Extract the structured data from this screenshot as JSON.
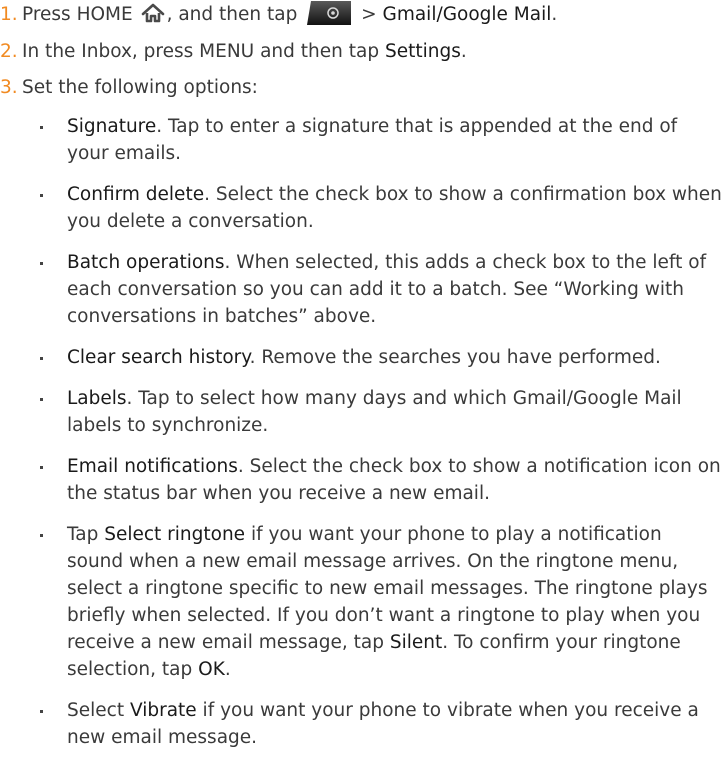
{
  "steps": [
    {
      "num": "1.",
      "p1": "Press HOME ",
      "p2": ", and then tap ",
      "p3": " > ",
      "h1": "Gmail/Google Mail",
      "p4": "."
    },
    {
      "num": "2.",
      "p1": "In the Inbox, press MENU and then tap ",
      "h1": "Settings",
      "p2": "."
    },
    {
      "num": "3.",
      "p1": "Set the following options:"
    }
  ],
  "icons": {
    "home": "home-icon",
    "launcher": "all-apps-launcher-icon"
  },
  "options": [
    {
      "pre": "",
      "hl": "Signature",
      "text": ". Tap to enter a signature that is appended at the end of your emails."
    },
    {
      "pre": "",
      "hl": "Confirm delete",
      "text": ". Select the check box to show a confirmation box when you delete a conversation."
    },
    {
      "pre": "",
      "hl": "Batch operations",
      "text": ". When selected, this adds a check box to the left of each conversation so you can add it to a batch. See “Working with conversations in batches” above."
    },
    {
      "pre": "",
      "hl": "Clear search history",
      "text": ". Remove the searches you have performed."
    },
    {
      "pre": "",
      "hl": "Labels",
      "text": ". Tap to select how many days and which Gmail/Google Mail labels to synchronize."
    },
    {
      "pre": "",
      "hl": "Email notifications",
      "text": ". Select the check box to show a notification icon on the status bar when you receive a new email."
    },
    {
      "pre": "Tap ",
      "hl": "Select ringtone",
      "text": " if you want your phone to play a notification sound when a new email message arrives. On the ringtone menu, select a ringtone specific to new email messages. The ringtone plays briefly when selected. If you don’t want a ringtone to play when you receive a new email message, tap ",
      "hl2": "Silent",
      "text2": ". To confirm your ringtone selection, tap ",
      "hl3": "OK",
      "text3": "."
    },
    {
      "pre": "Select ",
      "hl": "Vibrate",
      "text": " if you want your phone to vibrate when you receive a new email message."
    }
  ]
}
